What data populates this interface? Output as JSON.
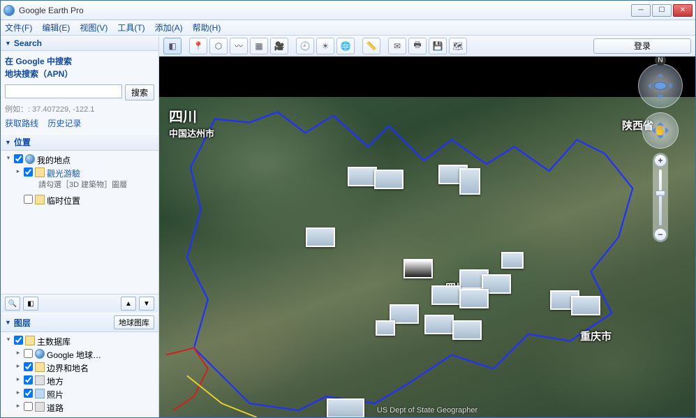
{
  "window": {
    "title": "Google Earth Pro"
  },
  "menu": {
    "file": "文件(F)",
    "edit": "编辑(E)",
    "view": "视图(V)",
    "tools": "工具(T)",
    "add": "添加(A)",
    "help": "帮助(H)"
  },
  "toolbar": {
    "login": "登录"
  },
  "search": {
    "header": "Search",
    "tab1": "在 Google 中搜索",
    "tab2": "地块搜索（APN）",
    "button": "搜索",
    "hint": "例如：: 37.407229, -122.1",
    "routes": "获取路线",
    "history": "历史记录"
  },
  "places": {
    "header": "位置",
    "my_places": "我的地点",
    "sightseeing": "觀光游驗",
    "sightseeing_note": "請勾選［3D 建築物］圖層",
    "temp": "临时位置"
  },
  "layers": {
    "header": "图层",
    "gallery": "地球图库",
    "primary_db": "主数据库",
    "google_earth": "Google 地球…",
    "borders_labels": "边界和地名",
    "places": "地方",
    "photos": "照片",
    "roads": "道路"
  },
  "map": {
    "sichuan_big": "四川",
    "dazhou": "中国达州市",
    "shaanxi": "陕西省",
    "sichuan_prov": "四川省",
    "chongqing": "重庆市",
    "attribution": "US Dept of State Geographer",
    "compass_n": "N"
  }
}
